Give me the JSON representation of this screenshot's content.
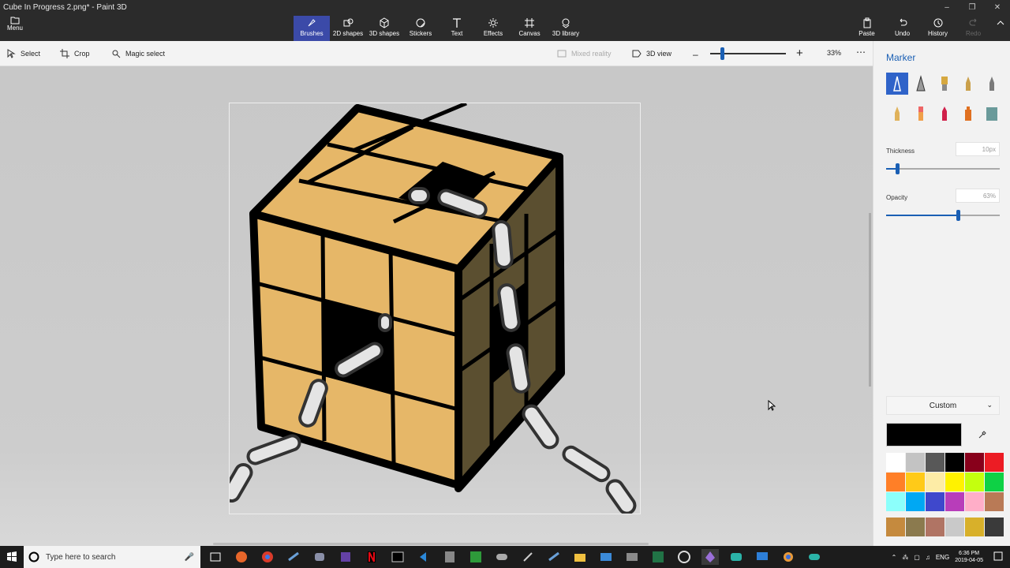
{
  "window": {
    "title": "Cube In Progress 2.png* - Paint 3D"
  },
  "ribbon": {
    "menu_label": "Menu",
    "tools": [
      {
        "label": "Brushes",
        "icon": "brush-icon",
        "active": true
      },
      {
        "label": "2D shapes",
        "icon": "2d-shapes-icon",
        "active": false
      },
      {
        "label": "3D shapes",
        "icon": "3d-shapes-icon",
        "active": false
      },
      {
        "label": "Stickers",
        "icon": "stickers-icon",
        "active": false
      },
      {
        "label": "Text",
        "icon": "text-icon",
        "active": false
      },
      {
        "label": "Effects",
        "icon": "effects-icon",
        "active": false
      },
      {
        "label": "Canvas",
        "icon": "canvas-icon",
        "active": false
      },
      {
        "label": "3D library",
        "icon": "3d-library-icon",
        "active": false
      }
    ],
    "right_tools": [
      {
        "label": "Paste",
        "icon": "paste-icon"
      },
      {
        "label": "Undo",
        "icon": "undo-icon"
      },
      {
        "label": "History",
        "icon": "history-icon"
      },
      {
        "label": "Redo",
        "icon": "redo-icon"
      }
    ]
  },
  "subbar": {
    "select": "Select",
    "crop": "Crop",
    "magic_select": "Magic select",
    "mixed_reality": "Mixed reality",
    "view_3d": "3D view",
    "zoom": "33%",
    "zoom_fraction": 0.1
  },
  "panel": {
    "title": "Marker",
    "brushes": [
      {
        "icon": "marker-icon",
        "active": true
      },
      {
        "icon": "calligraphy-pen-icon"
      },
      {
        "icon": "oil-brush-icon"
      },
      {
        "icon": "watercolor-icon"
      },
      {
        "icon": "pixel-pen-icon"
      },
      {
        "icon": "pencil-icon"
      },
      {
        "icon": "eraser-icon"
      },
      {
        "icon": "crayon-icon"
      },
      {
        "icon": "spray-can-icon"
      },
      {
        "icon": "fill-icon"
      }
    ],
    "thickness_label": "Thickness",
    "thickness_value": "10px",
    "opacity_label": "Opacity",
    "opacity_value": "63%",
    "opacity_fraction": 0.63,
    "thickness_fraction": 0.1,
    "color_mode": "Custom",
    "current_color": "#000000",
    "palette": [
      "#ffffff",
      "#c3c3c3",
      "#585858",
      "#000000",
      "#88001b",
      "#ec1c24",
      "#ff7f27",
      "#ffca18",
      "#fdeca6",
      "#fff200",
      "#c4ff0e",
      "#0ed145",
      "#8cfffb",
      "#00a8f3",
      "#3f48cc",
      "#b83dba",
      "#ffaec8",
      "#b97a56"
    ],
    "custom_palette": [
      "#c58a3e",
      "#8b7a4e",
      "#b07464",
      "#c9c9c9",
      "#d8b02a",
      "#3a3a3a"
    ]
  },
  "taskbar": {
    "search_placeholder": "Type here to search",
    "lang": "ENG",
    "time": "6:36 PM",
    "date": "2019-04-05"
  }
}
